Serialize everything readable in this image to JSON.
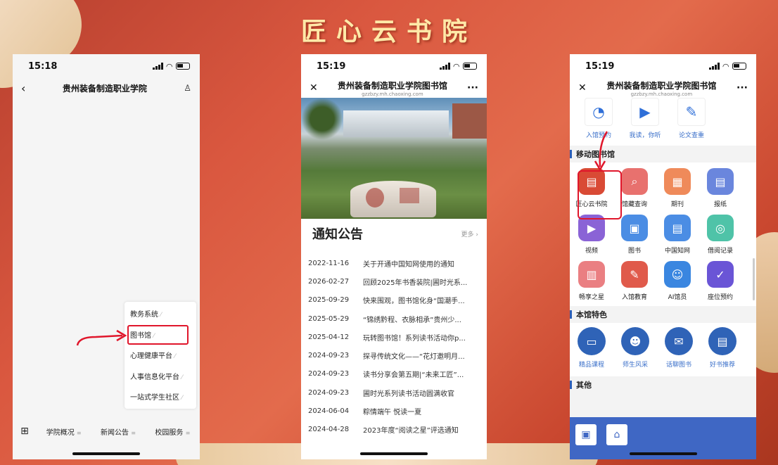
{
  "banner_title": "匠心云书院",
  "phone1": {
    "time": "15:18",
    "nav_title": "贵州装备制造职业学院",
    "menu_items": [
      "教务系统",
      "图书馆",
      "心理健康平台",
      "人事信息化平台",
      "一站式学生社区"
    ],
    "tabs": [
      "学院概况",
      "新闻公告",
      "校园服务"
    ]
  },
  "phone2": {
    "time": "15:19",
    "nav_title": "贵州装备制造职业学院图书馆",
    "nav_subtitle": "gzzbzy.mh.chaoxing.com",
    "notice_title": "通知公告",
    "more": "更多",
    "notices": [
      {
        "date": "2022-11-16",
        "text": "关于开通中国知网使用的通知"
      },
      {
        "date": "2026-02-27",
        "text": "回顾2025年书香装院|圃时光系..."
      },
      {
        "date": "2025-09-29",
        "text": "快来围观，图书馆化身“国潮手..."
      },
      {
        "date": "2025-05-29",
        "text": "“锦绣黔程、衣脉相承”贵州少..."
      },
      {
        "date": "2025-04-12",
        "text": "玩转图书馆！系列读书活动你p..."
      },
      {
        "date": "2024-09-23",
        "text": "探寻传统文化——“花灯邀明月..."
      },
      {
        "date": "2024-09-23",
        "text": "读书分享会第五期|“未来工匠”..."
      },
      {
        "date": "2024-09-23",
        "text": "圃时光系列读书活动圆满收官"
      },
      {
        "date": "2024-06-04",
        "text": "粽情端午 悦读一夏"
      },
      {
        "date": "2024-04-28",
        "text": "2023年度“阅读之星”评选通知"
      }
    ]
  },
  "phone3": {
    "time": "15:19",
    "nav_title": "贵州装备制造职业学院图书馆",
    "nav_subtitle": "gzzbzy.mh.chaoxing.com",
    "top_icons": [
      "入馆预约",
      "我读，你听",
      "论文查重"
    ],
    "section_mobile": "移动图书馆",
    "mobile_items": [
      "匠心云书院",
      "馆藏查询",
      "期刊",
      "报纸",
      "视频",
      "图书",
      "中国知网",
      "借阅记录",
      "畅享之星",
      "入馆教育",
      "AI馆员",
      "座位预约"
    ],
    "mobile_colors": [
      "#d94a35",
      "#e8716e",
      "#ef8a5a",
      "#6a86dd",
      "#8a63d6",
      "#4b8de4",
      "#4b8de4",
      "#4fc3a8",
      "#ea7f82",
      "#e05a4b",
      "#3a86e0",
      "#6a55d6"
    ],
    "section_feature": "本馆特色",
    "feature_items": [
      "精品课程",
      "师生风采",
      "话聊图书",
      "好书推荐"
    ],
    "section_other": "其他"
  }
}
